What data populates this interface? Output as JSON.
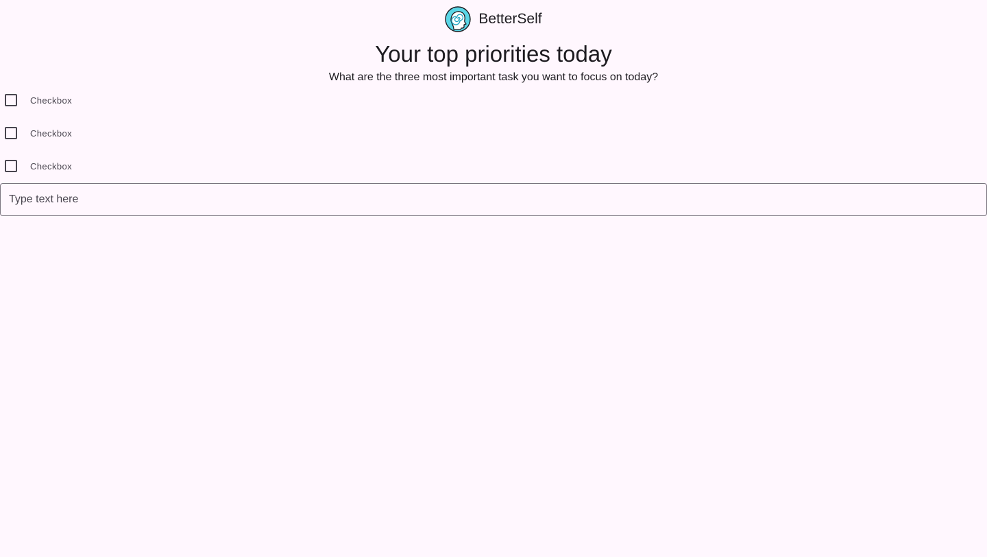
{
  "app": {
    "name": "BetterSelf",
    "logo_icon": "head-spiral-icon"
  },
  "main": {
    "title": "Your top priorities today",
    "subtitle": "What are the three most important task you want to focus on today?",
    "checkboxes": [
      {
        "label": "Checkbox",
        "checked": false
      },
      {
        "label": "Checkbox",
        "checked": false
      },
      {
        "label": "Checkbox",
        "checked": false
      }
    ],
    "text_field": {
      "placeholder": "Type text here",
      "value": ""
    }
  },
  "colors": {
    "background": "#fff7fe",
    "text": "#1d1b20",
    "outline": "#79747e",
    "logo_accent": "#5ad6e6"
  }
}
